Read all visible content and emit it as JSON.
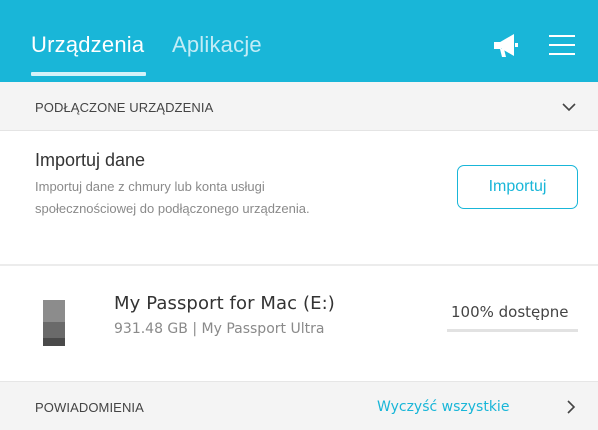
{
  "header": {
    "tabs": [
      {
        "label": "Urządzenia",
        "active": true
      },
      {
        "label": "Aplikacje",
        "active": false
      }
    ],
    "icons": [
      "megaphone-icon",
      "hamburger-menu-icon"
    ],
    "background_color": "#19b6d8"
  },
  "connected_devices": {
    "section_title": "PODŁĄCZONE URZĄDZENIA",
    "collapse_icon": "chevron-down-icon"
  },
  "import": {
    "title": "Importuj dane",
    "description": "Importuj dane z chmury lub konta usługi społecznościowej do podłączonego urządzenia.",
    "button_label": "Importuj"
  },
  "device": {
    "name": "My Passport for Mac (E:)",
    "details": "931.48 GB | My Passport Ultra",
    "availability": "100% dostępne",
    "icon": "drive-thumbnail-icon"
  },
  "notifications": {
    "section_title": "POWIADOMIENIA",
    "clear_label": "Wyczyść wszystkie",
    "open_icon": "chevron-right-icon"
  },
  "accent_color": "#19b6d8"
}
